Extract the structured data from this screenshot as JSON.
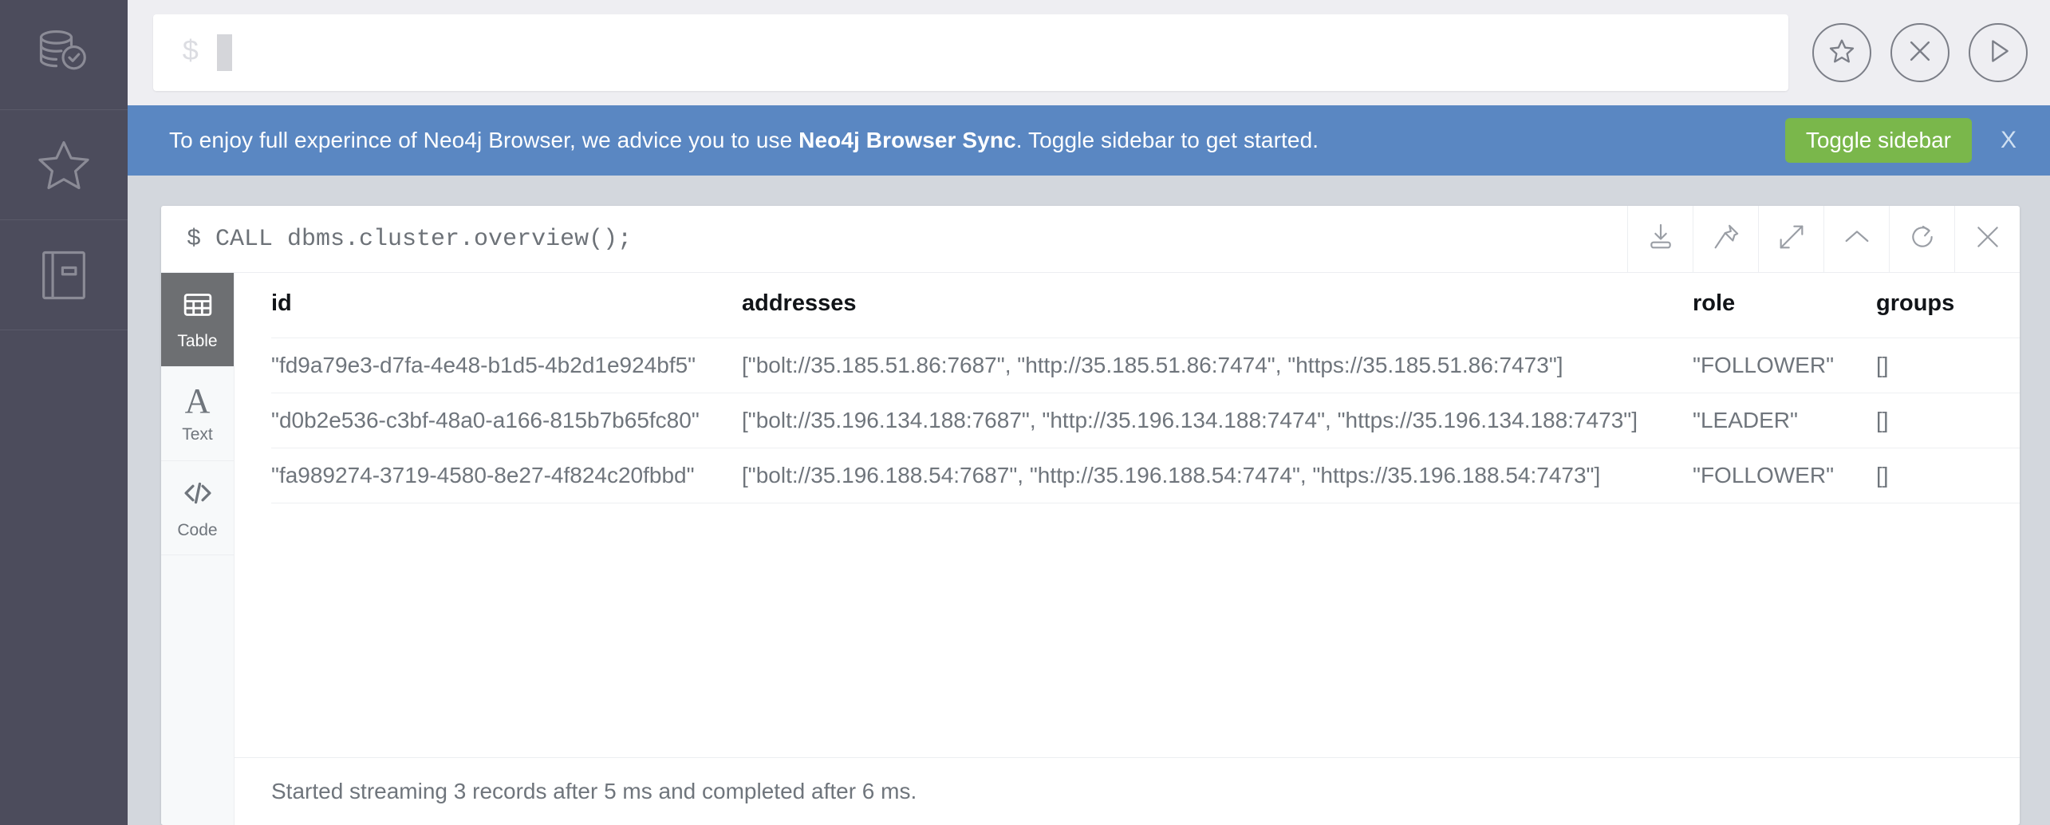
{
  "sidebar": {
    "items": [
      {
        "icon": "database-check-icon",
        "name": "sidebar-item-database",
        "label": "Database Information"
      },
      {
        "icon": "star-icon",
        "name": "sidebar-item-favorites",
        "label": "Favorites"
      },
      {
        "icon": "book-icon",
        "name": "sidebar-item-documents",
        "label": "Documents"
      }
    ]
  },
  "editor": {
    "prompt": "$",
    "value": "",
    "placeholder": "",
    "actions": [
      {
        "icon": "star-circle-icon",
        "name": "favorite-button",
        "label": "Favorite"
      },
      {
        "icon": "close-circle-icon",
        "name": "clear-editor-button",
        "label": "Clear"
      },
      {
        "icon": "play-circle-icon",
        "name": "run-query-button",
        "label": "Run"
      }
    ]
  },
  "banner": {
    "text_before": "To enjoy full experince of Neo4j Browser, we advice you to use ",
    "text_bold": "Neo4j Browser Sync",
    "text_after": ". Toggle sidebar to get started.",
    "button_label": "Toggle sidebar",
    "dismiss_label": "X",
    "background_color": "#5a87c2",
    "button_color": "#7ab74b"
  },
  "frame": {
    "command": "$ CALL dbms.cluster.overview();",
    "tools": [
      {
        "icon": "download-icon",
        "name": "download-button"
      },
      {
        "icon": "pin-icon",
        "name": "pin-frame-button"
      },
      {
        "icon": "expand-icon",
        "name": "fullscreen-button"
      },
      {
        "icon": "chevron-up-icon",
        "name": "collapse-frame-button"
      },
      {
        "icon": "refresh-icon",
        "name": "rerun-frame-button"
      },
      {
        "icon": "close-icon",
        "name": "close-frame-button"
      }
    ],
    "view_tabs": [
      {
        "icon": "table-icon",
        "label": "Table",
        "name": "tab-table",
        "active": true
      },
      {
        "icon": "text-icon",
        "label": "Text",
        "name": "tab-text",
        "active": false
      },
      {
        "icon": "code-icon",
        "label": "Code",
        "name": "tab-code",
        "active": false
      }
    ],
    "status": "Started streaming 3 records after 5 ms and completed after 6 ms."
  },
  "table": {
    "columns": [
      "id",
      "addresses",
      "role",
      "groups"
    ],
    "rows": [
      {
        "id": "\"fd9a79e3-d7fa-4e48-b1d5-4b2d1e924bf5\"",
        "addresses": "[\"bolt://35.185.51.86:7687\", \"http://35.185.51.86:7474\", \"https://35.185.51.86:7473\"]",
        "role": "\"FOLLOWER\"",
        "groups": "[]"
      },
      {
        "id": "\"d0b2e536-c3bf-48a0-a166-815b7b65fc80\"",
        "addresses": "[\"bolt://35.196.134.188:7687\", \"http://35.196.134.188:7474\", \"https://35.196.134.188:7473\"]",
        "role": "\"LEADER\"",
        "groups": "[]"
      },
      {
        "id": "\"fa989274-3719-4580-8e27-4f824c20fbbd\"",
        "addresses": "[\"bolt://35.196.188.54:7687\", \"http://35.196.188.54:7474\", \"https://35.196.188.54:7473\"]",
        "role": "\"FOLLOWER\"",
        "groups": "[]"
      }
    ]
  }
}
